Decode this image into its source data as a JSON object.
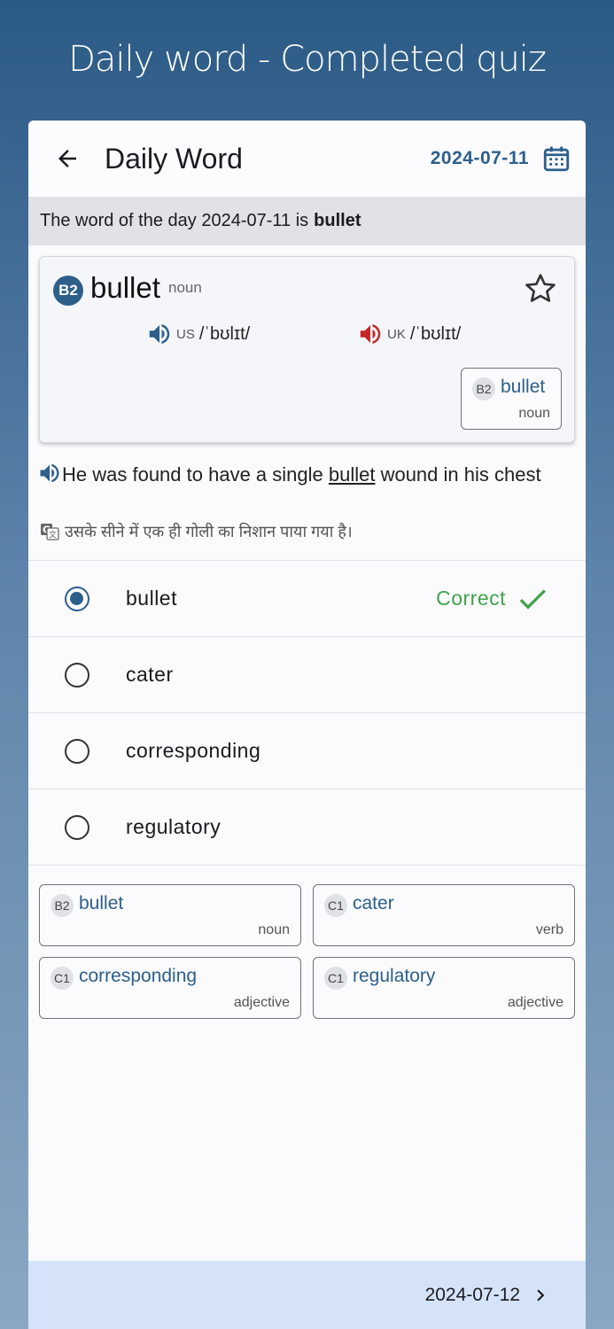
{
  "caption": "Daily word - Completed quiz",
  "appbar": {
    "title": "Daily Word",
    "date": "2024-07-11"
  },
  "banner": {
    "prefix": "The word of the day 2024-07-11 is",
    "word": "bullet"
  },
  "word_card": {
    "level": "B2",
    "word": "bullet",
    "pos": "noun",
    "us_tag": "US",
    "us_ipa": "/ˈbʊlɪt/",
    "uk_tag": "UK",
    "uk_ipa": "/ˈbʊlɪt/",
    "chip": {
      "level": "B2",
      "word": "bullet",
      "pos": "noun"
    }
  },
  "example": {
    "before": "He was found to have a single ",
    "highlight": "bullet",
    "after": " wound in his chest",
    "translation": "उसके सीने में एक ही गोली का निशान पाया गया है।"
  },
  "quiz": {
    "options": [
      "bullet",
      "cater",
      "corresponding",
      "regulatory"
    ],
    "selected": 0,
    "result": "Correct"
  },
  "word_chips": [
    {
      "level": "B2",
      "word": "bullet",
      "pos": "noun"
    },
    {
      "level": "C1",
      "word": "cater",
      "pos": "verb"
    },
    {
      "level": "C1",
      "word": "corresponding",
      "pos": "adjective"
    },
    {
      "level": "C1",
      "word": "regulatory",
      "pos": "adjective"
    }
  ],
  "footer": {
    "next_date": "2024-07-12"
  },
  "colors": {
    "primary": "#2d5f8b",
    "correct": "#3fa34d",
    "uk_speaker": "#c62828"
  }
}
